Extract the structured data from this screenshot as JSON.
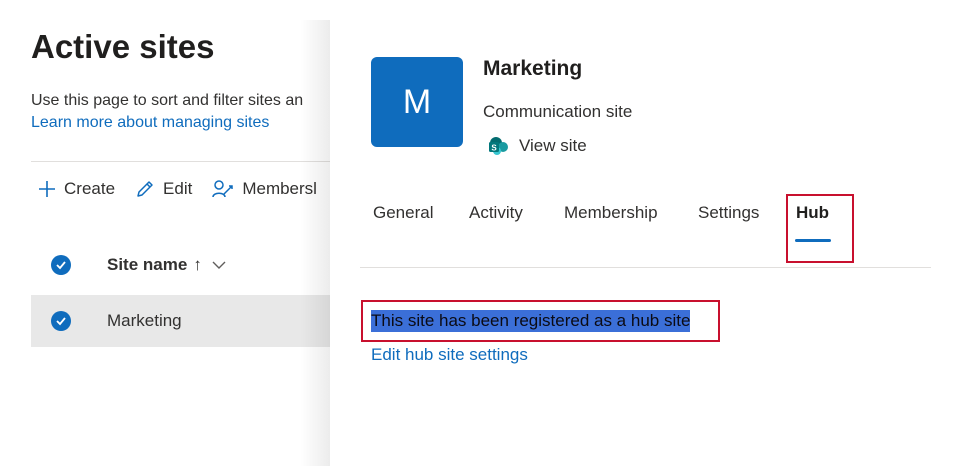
{
  "background_page": {
    "title": "Active sites",
    "description": "Use this page to sort and filter sites an",
    "learn_link": "Learn more about managing sites",
    "toolbar": {
      "create_label": "Create",
      "edit_label": "Edit",
      "membership_label": "Membersl"
    },
    "list": {
      "column_header": "Site name",
      "sort_arrow": "↑",
      "rows": [
        {
          "name": "Marketing",
          "selected": true
        }
      ]
    }
  },
  "panel": {
    "site_initial": "M",
    "site_title": "Marketing",
    "site_type": "Communication site",
    "view_site_label": "View site",
    "tabs": [
      {
        "label": "General",
        "active": false
      },
      {
        "label": "Activity",
        "active": false
      },
      {
        "label": "Membership",
        "active": false
      },
      {
        "label": "Settings",
        "active": false
      },
      {
        "label": "Hub",
        "active": true
      }
    ],
    "hub_message": "This site has been registered as a hub site",
    "edit_hub_link": "Edit hub site settings"
  },
  "colors": {
    "accent": "#0f6cbd",
    "highlight_border": "#c8102e",
    "selection_highlight": "#3b6fd8",
    "selected_row": "#e8e8e8"
  },
  "icons": {
    "create": "plus-icon",
    "edit": "pencil-icon",
    "membership": "people-icon",
    "view_site": "sharepoint-icon",
    "select": "checkmark-circle-icon",
    "sort": "chevron-down-icon"
  }
}
